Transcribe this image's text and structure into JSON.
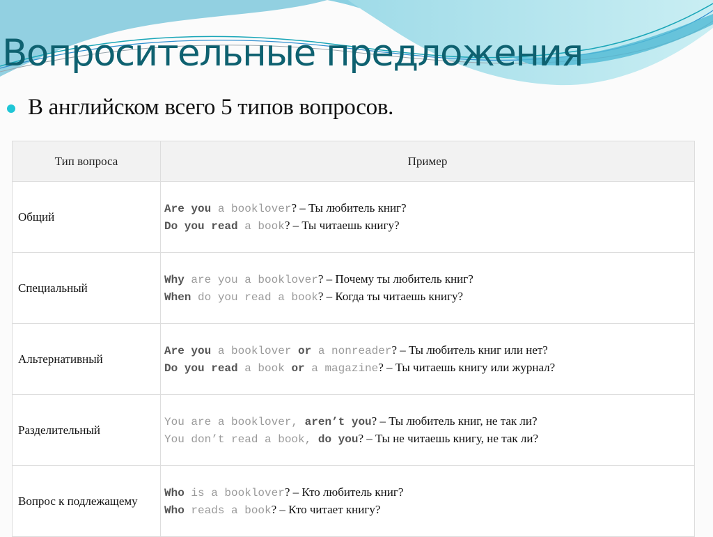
{
  "slide": {
    "title": "Вопросительные предложения",
    "bullet": "В английском всего 5 типов вопросов.",
    "colors": {
      "title": "#0e6170",
      "bullet_dot": "#1fc6d6",
      "wave_light": "#a6dfe8",
      "wave_mid": "#4fb9d4",
      "keyword_text": "#555555",
      "light_text": "#9a9a9a"
    }
  },
  "table": {
    "headers": [
      "Тип вопроса",
      "Пример"
    ],
    "rows": [
      {
        "type": "Общий",
        "examples": [
          [
            {
              "t": "Are you",
              "s": "kw"
            },
            {
              "t": " a booklover",
              "s": "lt"
            },
            {
              "t": "? – Ты любитель книг?",
              "s": "ru"
            }
          ],
          [
            {
              "t": "Do you read",
              "s": "kw"
            },
            {
              "t": " a book",
              "s": "lt"
            },
            {
              "t": "? – Ты читаешь книгу?",
              "s": "ru"
            }
          ]
        ]
      },
      {
        "type": "Специальный",
        "examples": [
          [
            {
              "t": "Why",
              "s": "kw"
            },
            {
              "t": " are you a booklover",
              "s": "lt"
            },
            {
              "t": "? – Почему ты любитель книг?",
              "s": "ru"
            }
          ],
          [
            {
              "t": "When",
              "s": "kw"
            },
            {
              "t": " do you read a book",
              "s": "lt"
            },
            {
              "t": "? – Когда ты читаешь книгу?",
              "s": "ru"
            }
          ]
        ]
      },
      {
        "type": "Альтернативный",
        "examples": [
          [
            {
              "t": "Are you",
              "s": "kw"
            },
            {
              "t": " a booklover ",
              "s": "lt"
            },
            {
              "t": "or",
              "s": "kw"
            },
            {
              "t": " a nonreader",
              "s": "lt"
            },
            {
              "t": "? – Ты любитель книг или нет?",
              "s": "ru"
            }
          ],
          [
            {
              "t": "Do you read",
              "s": "kw"
            },
            {
              "t": " a book ",
              "s": "lt"
            },
            {
              "t": "or",
              "s": "kw"
            },
            {
              "t": " a magazine",
              "s": "lt"
            },
            {
              "t": "? – Ты читаешь книгу или журнал?",
              "s": "ru"
            }
          ]
        ]
      },
      {
        "type": "Разделительный",
        "examples": [
          [
            {
              "t": "You are a booklover, ",
              "s": "lt"
            },
            {
              "t": "aren’t you",
              "s": "kw"
            },
            {
              "t": "? – Ты любитель книг, не так ли?",
              "s": "ru"
            }
          ],
          [
            {
              "t": "You don’t read a book, ",
              "s": "lt"
            },
            {
              "t": "do you",
              "s": "kw"
            },
            {
              "t": "? – Ты не читаешь книгу, не так ли?",
              "s": "ru"
            }
          ]
        ]
      },
      {
        "type": "Вопрос к подлежащему",
        "examples": [
          [
            {
              "t": "Who",
              "s": "kw"
            },
            {
              "t": " is a booklover",
              "s": "lt"
            },
            {
              "t": "? – Кто любитель книг?",
              "s": "ru"
            }
          ],
          [
            {
              "t": "Who",
              "s": "kw"
            },
            {
              "t": " reads a book",
              "s": "lt"
            },
            {
              "t": "? – Кто читает книгу?",
              "s": "ru"
            }
          ]
        ]
      }
    ]
  }
}
